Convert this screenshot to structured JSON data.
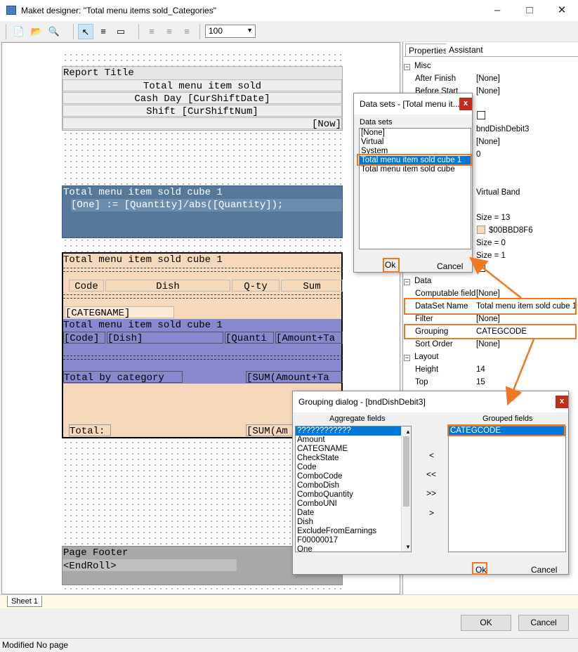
{
  "window": {
    "title": "Maket designer: \"Total menu items sold_Categories\""
  },
  "toolbar": {
    "zoom": "100"
  },
  "report": {
    "title_band": {
      "label": "Report Title",
      "line1": "Total menu item sold",
      "line2": "Cash Day [CurShiftDate]",
      "line3": "Shift [CurShiftNum]",
      "now": "[Now]"
    },
    "virtual_band": {
      "label": "Total menu item sold cube 1",
      "expr": "[One] := [Quantity]/abs([Quantity]);"
    },
    "header_band": {
      "label": "Total menu item sold cube 1",
      "col_code": "Code",
      "col_dish": "Dish",
      "col_qty": "Q-ty",
      "col_sum": "Sum",
      "categname": "[CATEGNAME]"
    },
    "data_band": {
      "label": "Total menu item sold cube 1",
      "f_code": "[Code]",
      "f_dish": "[Dish]",
      "f_qty": "[Quanti",
      "f_amount": "[Amount+Ta"
    },
    "category_band": {
      "label": "Total by category",
      "sum": "[SUM(Amount+Ta"
    },
    "total_band": {
      "label": "Total:",
      "sum": "[SUM(Am"
    },
    "footer_band": {
      "label": "Page Footer",
      "endroll": "<EndRoll>"
    }
  },
  "properties": {
    "tabs": [
      "Properties",
      "Assistant"
    ],
    "misc_label": "Misc",
    "data_label": "Data",
    "layout_label": "Layout",
    "after_finish_key": "After Finish",
    "after_finish_val": "[None]",
    "before_start_key": "Before Start",
    "before_start_val": "[None]",
    "name_val": "bndDishDebit3",
    "none2_val": "[None]",
    "zero_val": "0",
    "virtual_val": "Virtual Band",
    "size13_val": "Size = 13",
    "color_val": "$00BBD8F6",
    "size0_val": "Size = 0",
    "size1_val": "Size = 1",
    "computable_key": "Computable field",
    "computable_val": "[None]",
    "dataset_key": "DataSet Name",
    "dataset_val": "Total menu item sold cube 1",
    "filter_key": "Filter",
    "filter_val": "[None]",
    "grouping_key": "Grouping",
    "grouping_val": "CATEGCODE",
    "sortorder_key": "Sort Order",
    "sortorder_val": "[None]",
    "height_key": "Height",
    "height_val": "14",
    "top_key": "Top",
    "top_val": "15"
  },
  "datasets_dialog": {
    "title": "Data sets - [Total menu it...",
    "list_label": "Data sets",
    "items": [
      "[None]",
      "Virtual",
      "System",
      "Total menu item sold cube 1",
      "Total menu item sold cube"
    ],
    "selected_index": 3,
    "ok": "Ok",
    "cancel": "Cancel"
  },
  "grouping_dialog": {
    "title": "Grouping dialog - [bndDishDebit3]",
    "aggregate_label": "Aggregate fields",
    "grouped_label": "Grouped fields",
    "aggregate_items": [
      "????????????",
      "Amount",
      "CATEGNAME",
      "CheckState",
      "Code",
      "ComboCode",
      "ComboDish",
      "ComboQuantity",
      "ComboUNI",
      "Date",
      "Dish",
      "ExcludeFromEarnings",
      "F00000017",
      "One"
    ],
    "grouped_items": [
      "CATEGCODE"
    ],
    "move_left": "<",
    "move_all_left": "<<",
    "move_all_right": ">>",
    "move_right": ">",
    "ok": "Ok",
    "cancel": "Cancel"
  },
  "sheet_tab": "Sheet 1",
  "buttons": {
    "ok": "OK",
    "cancel": "Cancel"
  },
  "status": "Modified No page",
  "colors": {
    "highlight": "#f07820",
    "band_blue": "#56789a",
    "band_peach": "#f6d8bb",
    "band_purple": "#8888d0",
    "selection": "#0078d7"
  }
}
